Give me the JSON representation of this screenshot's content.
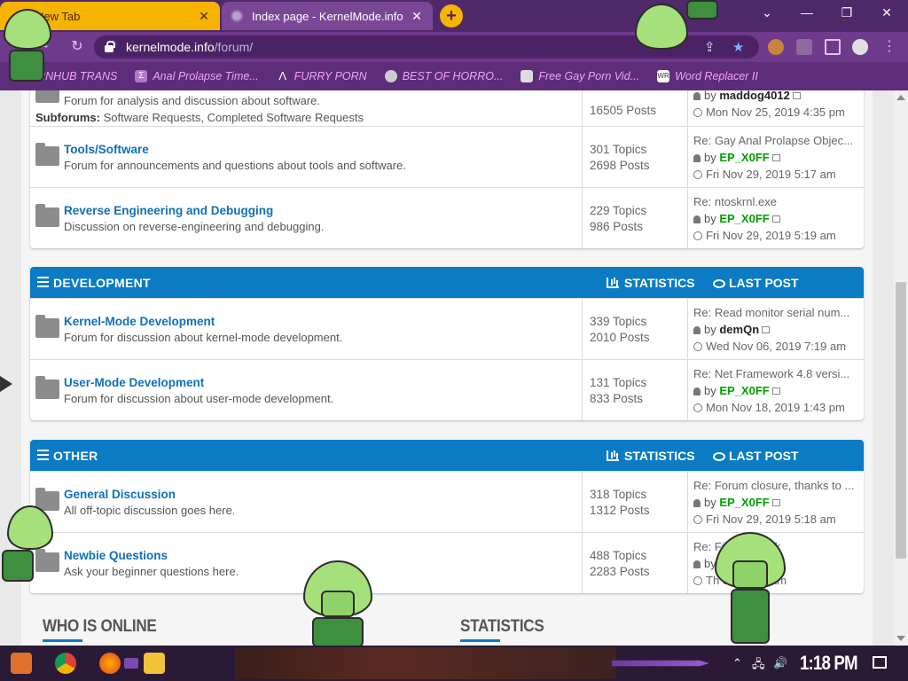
{
  "browser": {
    "tabs": [
      {
        "title": "New Tab",
        "active": false
      },
      {
        "title": "Index page - KernelMode.info",
        "active": true
      }
    ],
    "new_tab_label": "+",
    "url": {
      "host": "kernelmode.info",
      "path": "/forum/"
    },
    "bookmarks": [
      {
        "label": "PORNHUB TRANS",
        "icon": "pornhub-icon"
      },
      {
        "label": "Anal Prolapse Time...",
        "icon": "bookmark-icon"
      },
      {
        "label": "FURRY PORN",
        "icon": "lambda-icon"
      },
      {
        "label": "BEST OF HORRO...",
        "icon": "globe-icon"
      },
      {
        "label": "Free Gay Porn Vid...",
        "icon": "site-icon"
      },
      {
        "label": "Word Replacer II",
        "icon": "extension-icon"
      }
    ]
  },
  "top_block": {
    "rows": [
      {
        "desc": "Forum for analysis and discussion about software.",
        "subforums_label": "Subforums:",
        "subforums": "Software Requests, Completed Software Requests",
        "stats": "16505 Posts",
        "last_user": "maddog4012",
        "last_date": "Mon Nov 25, 2019 4:35 pm"
      },
      {
        "title": "Tools/Software",
        "desc": "Forum for announcements and questions about tools and software.",
        "topics": "301 Topics",
        "posts": "2698 Posts",
        "last_title": "Re: Gay Anal Prolapse Objec...",
        "last_user": "EP_X0FF",
        "last_date": "Fri Nov 29, 2019 5:17 am"
      },
      {
        "title": "Reverse Engineering and Debugging",
        "desc": "Discussion on reverse-engineering and debugging.",
        "topics": "229 Topics",
        "posts": "986 Posts",
        "last_title": "Re: ntoskrnl.exe",
        "last_user": "EP_X0FF",
        "last_date": "Fri Nov 29, 2019 5:19 am"
      }
    ]
  },
  "by_label": "by",
  "statistics_label": "STATISTICS",
  "last_post_label": "LAST POST",
  "development": {
    "title": "DEVELOPMENT",
    "rows": [
      {
        "title": "Kernel-Mode Development",
        "desc": "Forum for discussion about kernel-mode development.",
        "topics": "339 Topics",
        "posts": "2010 Posts",
        "last_title": "Re: Read monitor serial num...",
        "last_user": "demQn",
        "last_date": "Wed Nov 06, 2019 7:19 am"
      },
      {
        "title": "User-Mode Development",
        "desc": "Forum for discussion about user-mode development.",
        "topics": "131 Topics",
        "posts": "833 Posts",
        "last_title": "Re: Net Framework 4.8 versi...",
        "last_user": "EP_X0FF",
        "last_date": "Mon Nov 18, 2019 1:43 pm"
      }
    ]
  },
  "other": {
    "title": "OTHER",
    "rows": [
      {
        "title": "General Discussion",
        "desc": "All off-topic discussion goes here.",
        "topics": "318 Topics",
        "posts": "1312 Posts",
        "last_title": "Re: Forum closure, thanks to ...",
        "last_user": "EP_X0FF",
        "last_date": "Fri Nov 29, 2019 5:18 am"
      },
      {
        "title": "Newbie Questions",
        "desc": "Ask your beginner questions here.",
        "topics": "488 Topics",
        "posts": "2283 Posts",
        "last_title": "Re: Fil       eCallback",
        "last_user_partial": "by",
        "last_date": "Th          019 6:33 am"
      }
    ]
  },
  "sections": {
    "who_is_online": "WHO IS ONLINE",
    "statistics": "STATISTICS"
  },
  "taskbar": {
    "time": "1:18 PM"
  },
  "colors": {
    "category_header": "#0b7bc4",
    "forum_link": "#1070b8",
    "moderator_user": "#00a000",
    "tab_bar": "#50296b"
  }
}
